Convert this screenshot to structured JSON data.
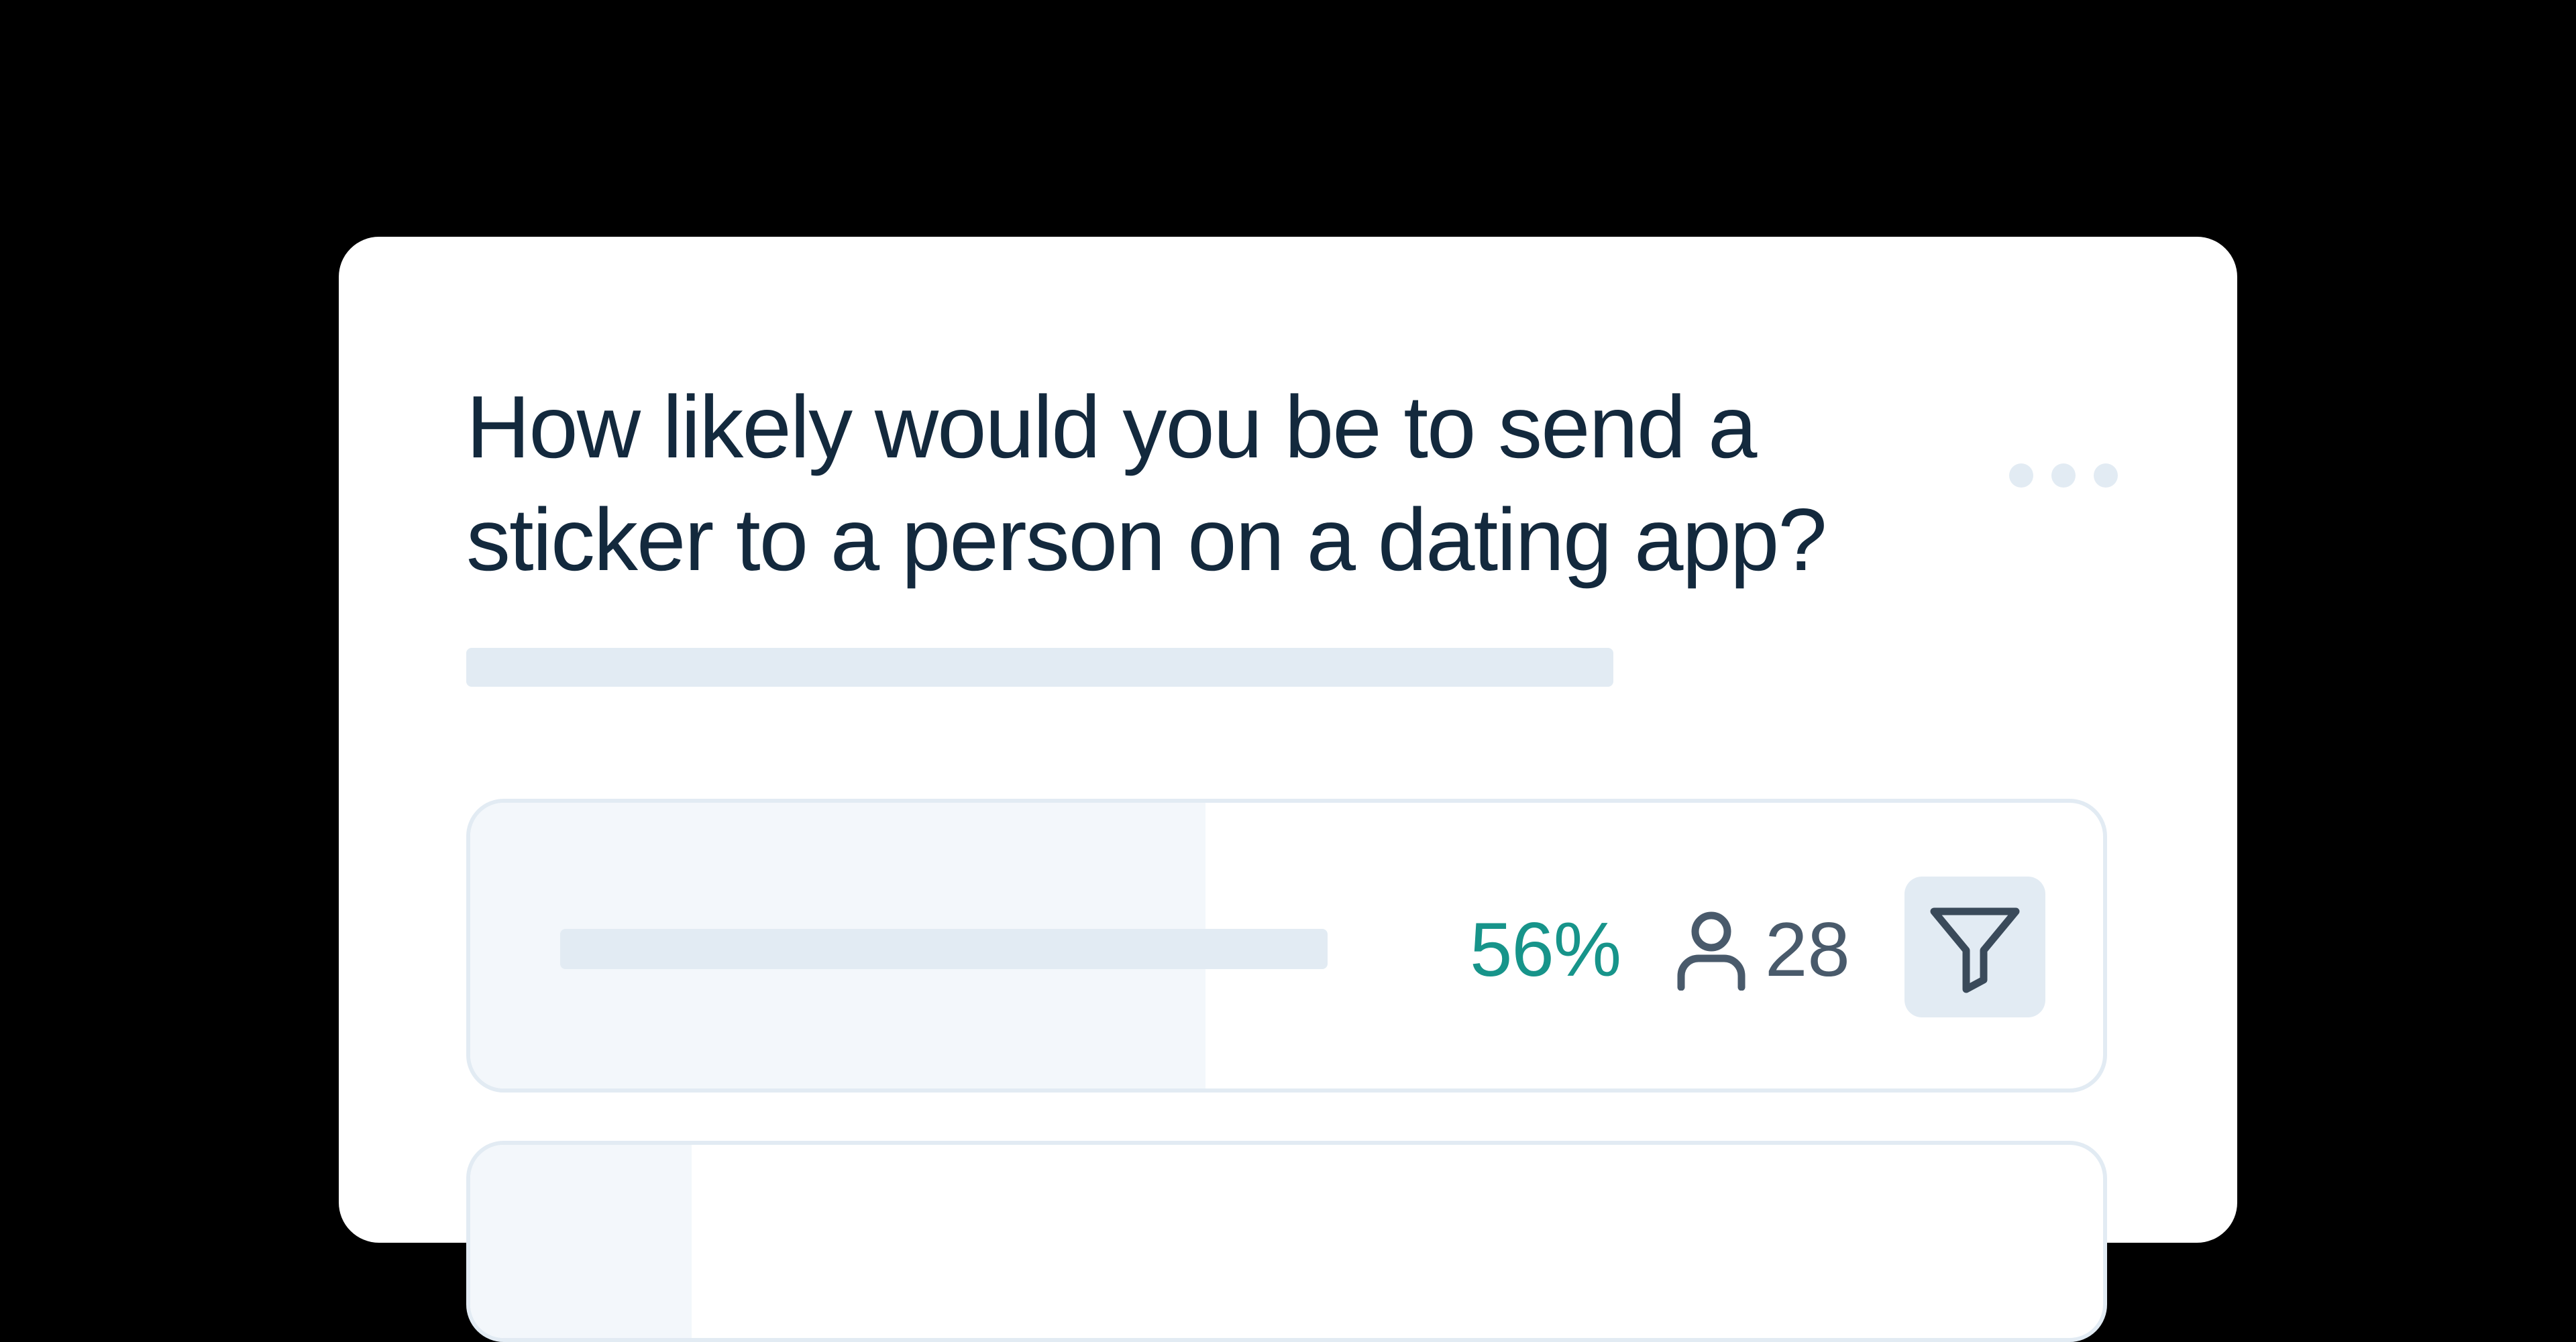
{
  "poll": {
    "question": "How likely would you be to send a sticker to a person on a dating app?",
    "options": [
      {
        "percent_label": "56%",
        "percent": 56,
        "count": "28"
      }
    ]
  },
  "icons": {
    "more": "more-horizontal-icon",
    "respondents": "user-icon",
    "filter": "filter-funnel-icon"
  },
  "colors": {
    "background": "#000000",
    "card": "#ffffff",
    "question_text": "#13293d",
    "accent_percent": "#17948a",
    "count_text": "#495a6b",
    "placeholder": "#e2ebf3",
    "option_fill": "#f3f7fb"
  }
}
